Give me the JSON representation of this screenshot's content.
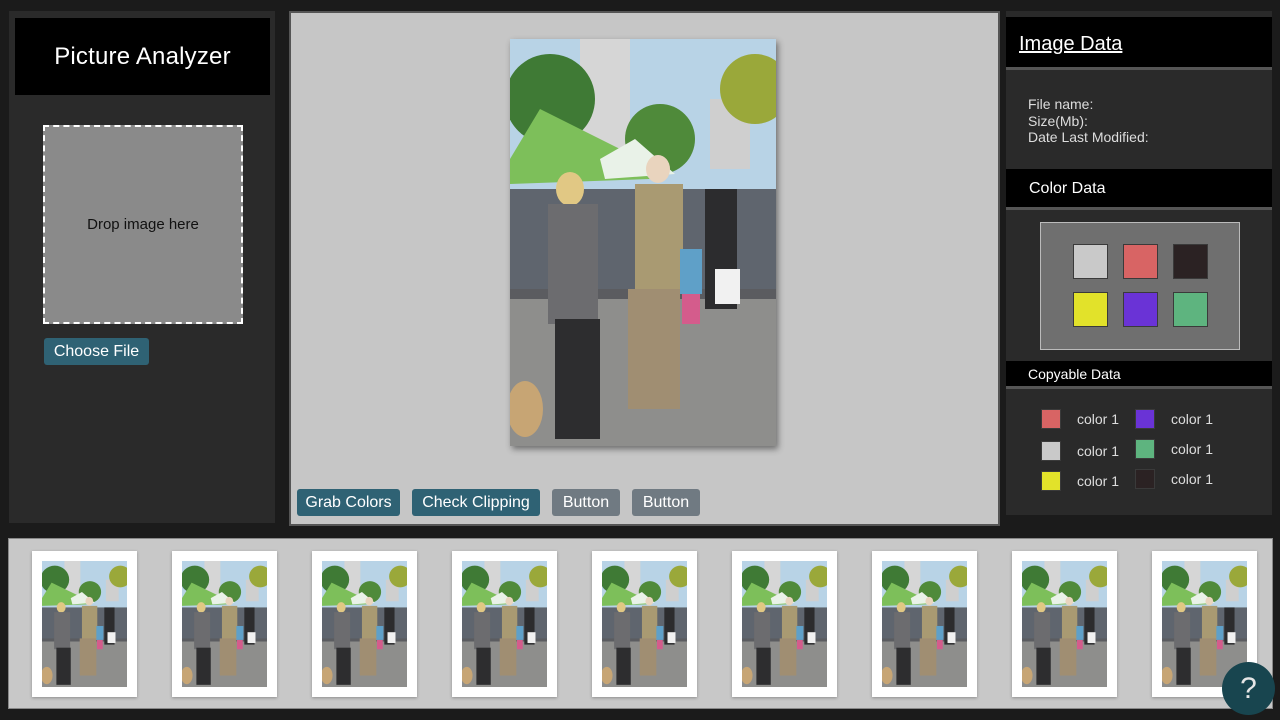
{
  "app": {
    "title": "Picture Analyzer"
  },
  "upload": {
    "drop_text": "Drop image here",
    "choose_file_label": "Choose File"
  },
  "toolbar": {
    "buttons": [
      "Grab Colors",
      "Check Clipping",
      "Button",
      "Button"
    ]
  },
  "image_data": {
    "title": "Image Data",
    "file_name_label": "File name:",
    "size_label": "Size(Mb):",
    "date_label": "Date Last Modified:"
  },
  "color_data": {
    "title": "Color Data",
    "palette": [
      "#c9c9c9",
      "#d86464",
      "#2b2223",
      "#e2e22a",
      "#6a33d6",
      "#5eb47f"
    ]
  },
  "copyable_data": {
    "title": "Copyable Data",
    "items": [
      {
        "color": "#d86464",
        "label": "color 1"
      },
      {
        "color": "#c9c9c9",
        "label": "color 1"
      },
      {
        "color": "#e2e22a",
        "label": "color 1"
      },
      {
        "color": "#6a33d6",
        "label": "color 1"
      },
      {
        "color": "#5eb47f",
        "label": "color 1"
      },
      {
        "color": "#2b2223",
        "label": "color 1"
      }
    ]
  },
  "filmstrip": {
    "thumbnail_count": 9
  },
  "help": {
    "label": "?"
  }
}
